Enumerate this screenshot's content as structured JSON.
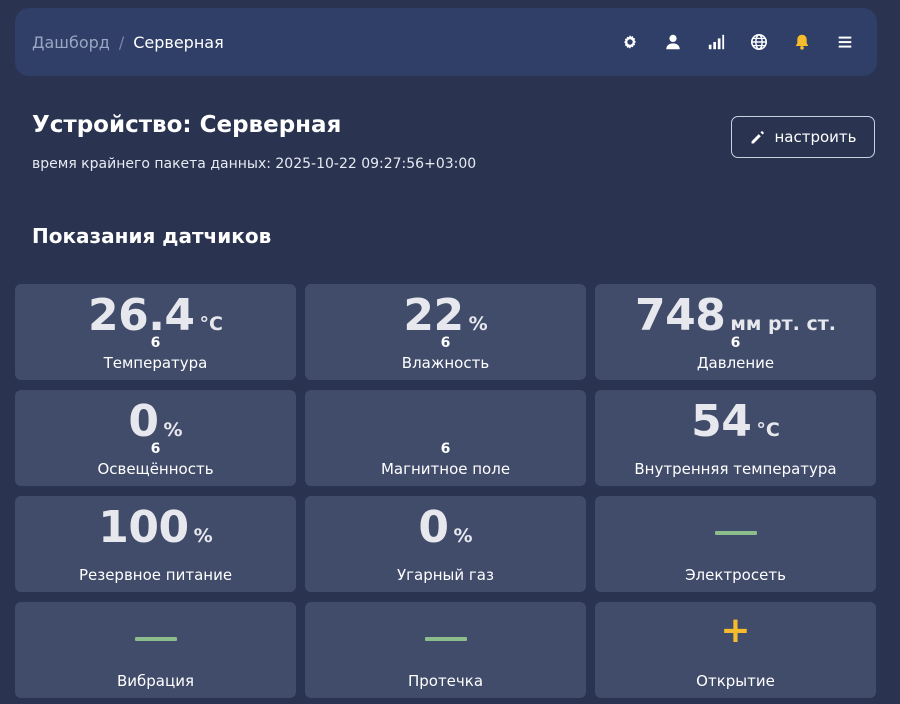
{
  "breadcrumb": {
    "parent": "Дашборд",
    "separator": "/",
    "current": "Серверная"
  },
  "toolbar_icons": [
    "settings-icon",
    "user-icon",
    "signal-icon",
    "globe-icon",
    "bell-icon",
    "menu-icon"
  ],
  "colors": {
    "accent_bell": "#f5bd2e",
    "ok_dash": "#8cbd8c",
    "alert_plus": "#f5bd2e"
  },
  "device": {
    "title": "Устройство: Серверная",
    "last_packet": "время крайнего пакета данных: 2025-10-22 09:27:56+03:00",
    "configure_label": "настроить"
  },
  "section_title": "Показания датчиков",
  "sensors": [
    {
      "value": "26.4",
      "unit": "°C",
      "sub": "6",
      "label": "Температура"
    },
    {
      "value": "22",
      "unit": "%",
      "sub": "6",
      "label": "Влажность"
    },
    {
      "value": "748",
      "unit": "мм рт. ст.",
      "sub": "6",
      "label": "Давление"
    },
    {
      "value": "0",
      "unit": "%",
      "sub": "6",
      "label": "Освещённость"
    },
    {
      "value": "",
      "unit": "",
      "sub": "6",
      "label": "Магнитное поле"
    },
    {
      "value": "54",
      "unit": "°C",
      "sub": "",
      "label": "Внутренняя температура"
    },
    {
      "value": "100",
      "unit": "%",
      "sub": "",
      "label": "Резервное питание"
    },
    {
      "value": "0",
      "unit": "%",
      "sub": "",
      "label": "Угарный газ"
    },
    {
      "state": "dash",
      "label": "Электросеть"
    },
    {
      "state": "dash",
      "label": "Вибрация"
    },
    {
      "state": "dash",
      "label": "Протечка"
    },
    {
      "state": "plus",
      "symbol": "+",
      "label": "Открытие"
    }
  ]
}
